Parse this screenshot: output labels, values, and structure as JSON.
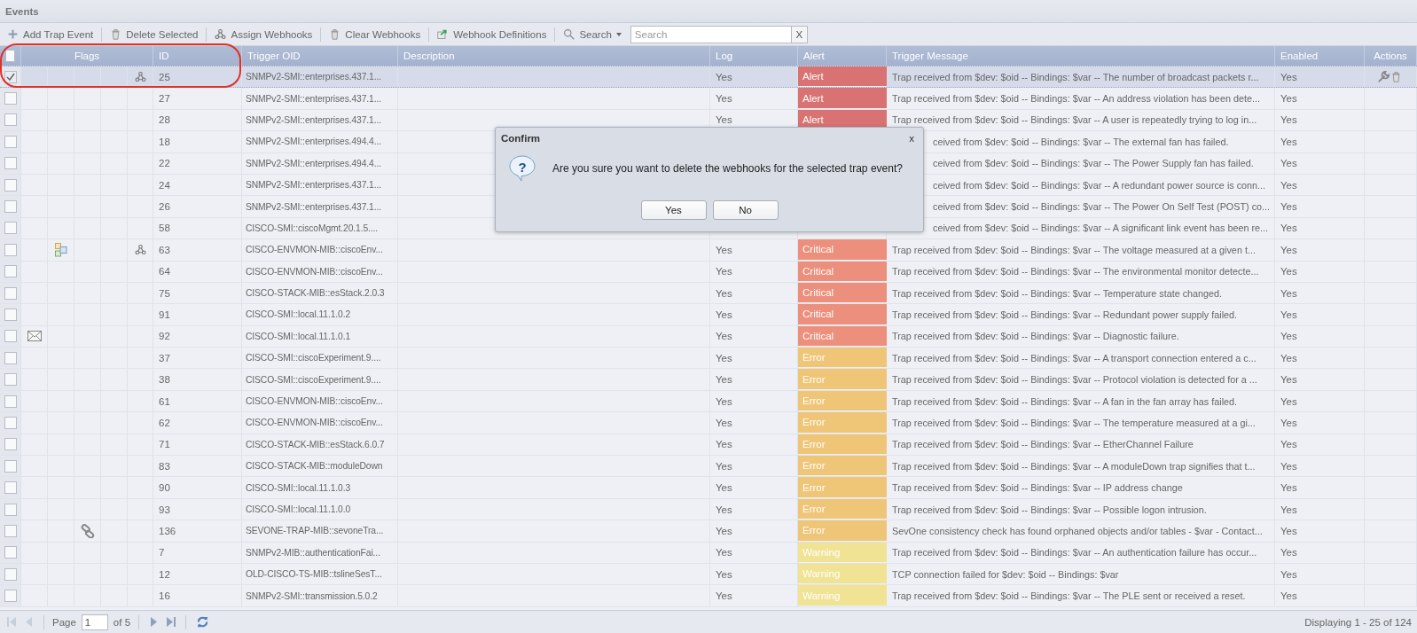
{
  "panel": {
    "title": "Events"
  },
  "toolbar": [
    {
      "kind": "button",
      "label": "Add Trap Event"
    },
    {
      "kind": "button",
      "label": "Delete Selected"
    },
    {
      "kind": "button",
      "label": "Assign Webhooks"
    },
    {
      "kind": "button",
      "label": "Clear Webhooks"
    },
    {
      "kind": "button",
      "label": "Webhook Definitions"
    },
    {
      "kind": "menu",
      "label": "Search"
    }
  ],
  "search": {
    "placeholder": "Search",
    "clear": "X"
  },
  "columns": {
    "flags": "Flags",
    "id": "ID",
    "oid": "Trigger OID",
    "description": "Description",
    "log": "Log",
    "alert": "Alert",
    "message": "Trigger Message",
    "enabled": "Enabled",
    "actions": "Actions"
  },
  "select_all": {
    "checked": false
  },
  "rows": [
    {
      "selected": true,
      "checked": true,
      "email": false,
      "grouped": false,
      "linked": false,
      "webhook": true,
      "id": "25",
      "oid": "SNMPv2-SMI::enterprises.437.1...",
      "log": "Yes",
      "alert": "Alert",
      "color": "#d97272",
      "message": "Trap received from $dev: $oid -- Bindings: $var -- The number of broadcast packets r...",
      "enabled": "Yes"
    },
    {
      "selected": false,
      "checked": false,
      "email": false,
      "grouped": false,
      "linked": false,
      "webhook": false,
      "id": "27",
      "oid": "SNMPv2-SMI::enterprises.437.1...",
      "log": "Yes",
      "alert": "Alert",
      "color": "#d97272",
      "message": "Trap received from $dev: $oid -- Bindings: $var -- An address violation has been dete...",
      "enabled": "Yes"
    },
    {
      "selected": false,
      "checked": false,
      "email": false,
      "grouped": false,
      "linked": false,
      "webhook": false,
      "id": "28",
      "oid": "SNMPv2-SMI::enterprises.437.1...",
      "log": "Yes",
      "alert": "Alert",
      "color": "#d97272",
      "message": "Trap received from $dev: $oid -- Bindings: $var -- A user is repeatedly trying to log in...",
      "enabled": "Yes"
    },
    {
      "selected": false,
      "checked": false,
      "email": false,
      "grouped": false,
      "linked": false,
      "webhook": false,
      "id": "18",
      "oid": "SNMPv2-SMI::enterprises.494.4...",
      "message": "ceived from $dev: $oid -- Bindings: $var -- The external fan has failed.",
      "enabled": "Yes"
    },
    {
      "selected": false,
      "checked": false,
      "email": false,
      "grouped": false,
      "linked": false,
      "webhook": false,
      "id": "22",
      "oid": "SNMPv2-SMI::enterprises.494.4...",
      "message": "ceived from $dev: $oid -- Bindings: $var -- The Power Supply fan has failed.",
      "enabled": "Yes"
    },
    {
      "selected": false,
      "checked": false,
      "email": false,
      "grouped": false,
      "linked": false,
      "webhook": false,
      "id": "24",
      "oid": "SNMPv2-SMI::enterprises.437.1...",
      "message": "ceived from $dev: $oid -- Bindings: $var -- A redundant power source is conn...",
      "enabled": "Yes"
    },
    {
      "selected": false,
      "checked": false,
      "email": false,
      "grouped": false,
      "linked": false,
      "webhook": false,
      "id": "26",
      "oid": "SNMPv2-SMI::enterprises.437.1...",
      "message": "ceived from $dev: $oid -- Bindings: $var -- The Power On Self Test (POST) co...",
      "enabled": "Yes"
    },
    {
      "selected": false,
      "checked": false,
      "email": false,
      "grouped": false,
      "linked": false,
      "webhook": false,
      "id": "58",
      "oid": "CISCO-SMI::ciscoMgmt.20.1.5....",
      "message": "ceived from $dev: $oid -- Bindings: $var -- A significant link event has been re...",
      "enabled": "Yes"
    },
    {
      "selected": false,
      "checked": false,
      "email": false,
      "grouped": true,
      "linked": false,
      "webhook": true,
      "id": "63",
      "oid": "CISCO-ENVMON-MIB::ciscoEnv...",
      "log": "Yes",
      "alert": "Critical",
      "color": "#ec8f7c",
      "message": "Trap received from $dev: $oid -- Bindings: $var -- The voltage measured at a given t...",
      "enabled": "Yes"
    },
    {
      "selected": false,
      "checked": false,
      "email": false,
      "grouped": false,
      "linked": false,
      "webhook": false,
      "id": "64",
      "oid": "CISCO-ENVMON-MIB::ciscoEnv...",
      "log": "Yes",
      "alert": "Critical",
      "color": "#ec8f7c",
      "message": "Trap received from $dev: $oid -- Bindings: $var -- The environmental monitor detecte...",
      "enabled": "Yes"
    },
    {
      "selected": false,
      "checked": false,
      "email": false,
      "grouped": false,
      "linked": false,
      "webhook": false,
      "id": "75",
      "oid": "CISCO-STACK-MIB::esStack.2.0.3",
      "log": "Yes",
      "alert": "Critical",
      "color": "#ec8f7c",
      "message": "Trap received from $dev: $oid -- Bindings: $var -- Temperature state changed.",
      "enabled": "Yes"
    },
    {
      "selected": false,
      "checked": false,
      "email": false,
      "grouped": false,
      "linked": false,
      "webhook": false,
      "id": "91",
      "oid": "CISCO-SMI::local.11.1.0.2",
      "log": "Yes",
      "alert": "Critical",
      "color": "#ec8f7c",
      "message": "Trap received from $dev: $oid -- Bindings: $var -- Redundant power supply failed.",
      "enabled": "Yes"
    },
    {
      "selected": false,
      "checked": false,
      "email": true,
      "grouped": false,
      "linked": false,
      "webhook": false,
      "id": "92",
      "oid": "CISCO-SMI::local.11.1.0.1",
      "log": "Yes",
      "alert": "Critical",
      "color": "#ec8f7c",
      "message": "Trap received from $dev: $oid -- Bindings: $var -- Diagnostic failure.",
      "enabled": "Yes"
    },
    {
      "selected": false,
      "checked": false,
      "email": false,
      "grouped": false,
      "linked": false,
      "webhook": false,
      "id": "37",
      "oid": "CISCO-SMI::ciscoExperiment.9....",
      "log": "Yes",
      "alert": "Error",
      "color": "#efc678",
      "message": "Trap received from $dev: $oid -- Bindings: $var -- A transport connection entered a c...",
      "enabled": "Yes"
    },
    {
      "selected": false,
      "checked": false,
      "email": false,
      "grouped": false,
      "linked": false,
      "webhook": false,
      "id": "38",
      "oid": "CISCO-SMI::ciscoExperiment.9....",
      "log": "Yes",
      "alert": "Error",
      "color": "#efc678",
      "message": "Trap received from $dev: $oid -- Bindings: $var -- Protocol violation is detected for a ...",
      "enabled": "Yes"
    },
    {
      "selected": false,
      "checked": false,
      "email": false,
      "grouped": false,
      "linked": false,
      "webhook": false,
      "id": "61",
      "oid": "CISCO-ENVMON-MIB::ciscoEnv...",
      "log": "Yes",
      "alert": "Error",
      "color": "#efc678",
      "message": "Trap received from $dev: $oid -- Bindings: $var -- A fan in the fan array has failed.",
      "enabled": "Yes"
    },
    {
      "selected": false,
      "checked": false,
      "email": false,
      "grouped": false,
      "linked": false,
      "webhook": false,
      "id": "62",
      "oid": "CISCO-ENVMON-MIB::ciscoEnv...",
      "log": "Yes",
      "alert": "Error",
      "color": "#efc678",
      "message": "Trap received from $dev: $oid -- Bindings: $var -- The temperature measured at a gi...",
      "enabled": "Yes"
    },
    {
      "selected": false,
      "checked": false,
      "email": false,
      "grouped": false,
      "linked": false,
      "webhook": false,
      "id": "71",
      "oid": "CISCO-STACK-MIB::esStack.6.0.7",
      "log": "Yes",
      "alert": "Error",
      "color": "#efc678",
      "message": "Trap received from $dev: $oid -- Bindings: $var -- EtherChannel Failure",
      "enabled": "Yes"
    },
    {
      "selected": false,
      "checked": false,
      "email": false,
      "grouped": false,
      "linked": false,
      "webhook": false,
      "id": "83",
      "oid": "CISCO-STACK-MIB::moduleDown",
      "log": "Yes",
      "alert": "Error",
      "color": "#efc678",
      "message": "Trap received from $dev: $oid -- Bindings: $var -- A moduleDown trap signifies that t...",
      "enabled": "Yes"
    },
    {
      "selected": false,
      "checked": false,
      "email": false,
      "grouped": false,
      "linked": false,
      "webhook": false,
      "id": "90",
      "oid": "CISCO-SMI::local.11.1.0.3",
      "log": "Yes",
      "alert": "Error",
      "color": "#efc678",
      "message": "Trap received from $dev: $oid -- Bindings: $var -- IP address change",
      "enabled": "Yes"
    },
    {
      "selected": false,
      "checked": false,
      "email": false,
      "grouped": false,
      "linked": false,
      "webhook": false,
      "id": "93",
      "oid": "CISCO-SMI::local.11.1.0.0",
      "log": "Yes",
      "alert": "Error",
      "color": "#efc678",
      "message": "Trap received from $dev: $oid -- Bindings: $var -- Possible logon intrusion.",
      "enabled": "Yes"
    },
    {
      "selected": false,
      "checked": false,
      "email": false,
      "grouped": false,
      "linked": true,
      "webhook": false,
      "id": "136",
      "oid": "SEVONE-TRAP-MIB::sevoneTra...",
      "log": "Yes",
      "alert": "Error",
      "color": "#efc678",
      "message": "SevOne consistency check has found orphaned objects and/or tables - $var - Contact...",
      "enabled": "Yes"
    },
    {
      "selected": false,
      "checked": false,
      "email": false,
      "grouped": false,
      "linked": false,
      "webhook": false,
      "id": "7",
      "oid": "SNMPv2-MIB::authenticationFai...",
      "log": "Yes",
      "alert": "Warning",
      "color": "#f0e394",
      "message": "Trap received from $dev: $oid -- Bindings: $var -- An authentication failure has occur...",
      "enabled": "Yes"
    },
    {
      "selected": false,
      "checked": false,
      "email": false,
      "grouped": false,
      "linked": false,
      "webhook": false,
      "id": "12",
      "oid": "OLD-CISCO-TS-MIB::tslineSesT...",
      "log": "Yes",
      "alert": "Warning",
      "color": "#f0e394",
      "message": "TCP connection failed for $dev: $oid -- Bindings: $var",
      "enabled": "Yes"
    },
    {
      "selected": false,
      "checked": false,
      "email": false,
      "grouped": false,
      "linked": false,
      "webhook": false,
      "id": "16",
      "oid": "SNMPv2-SMI::transmission.5.0.2",
      "log": "Yes",
      "alert": "Warning",
      "color": "#f0e394",
      "message": "Trap received from $dev: $oid -- Bindings: $var -- The PLE sent or received a reset.",
      "enabled": "Yes"
    }
  ],
  "pager": {
    "page_label": "Page",
    "page": "1",
    "of": "of 5",
    "first_disabled": true,
    "prev_disabled": true,
    "displaying": "Displaying 1 - 25 of 124"
  },
  "dialog": {
    "title": "Confirm",
    "close": "x",
    "icon_text": "?",
    "message": "Are you sure you want to delete the webhooks for the selected trap event?",
    "buttons": [
      "Yes",
      "No"
    ]
  }
}
